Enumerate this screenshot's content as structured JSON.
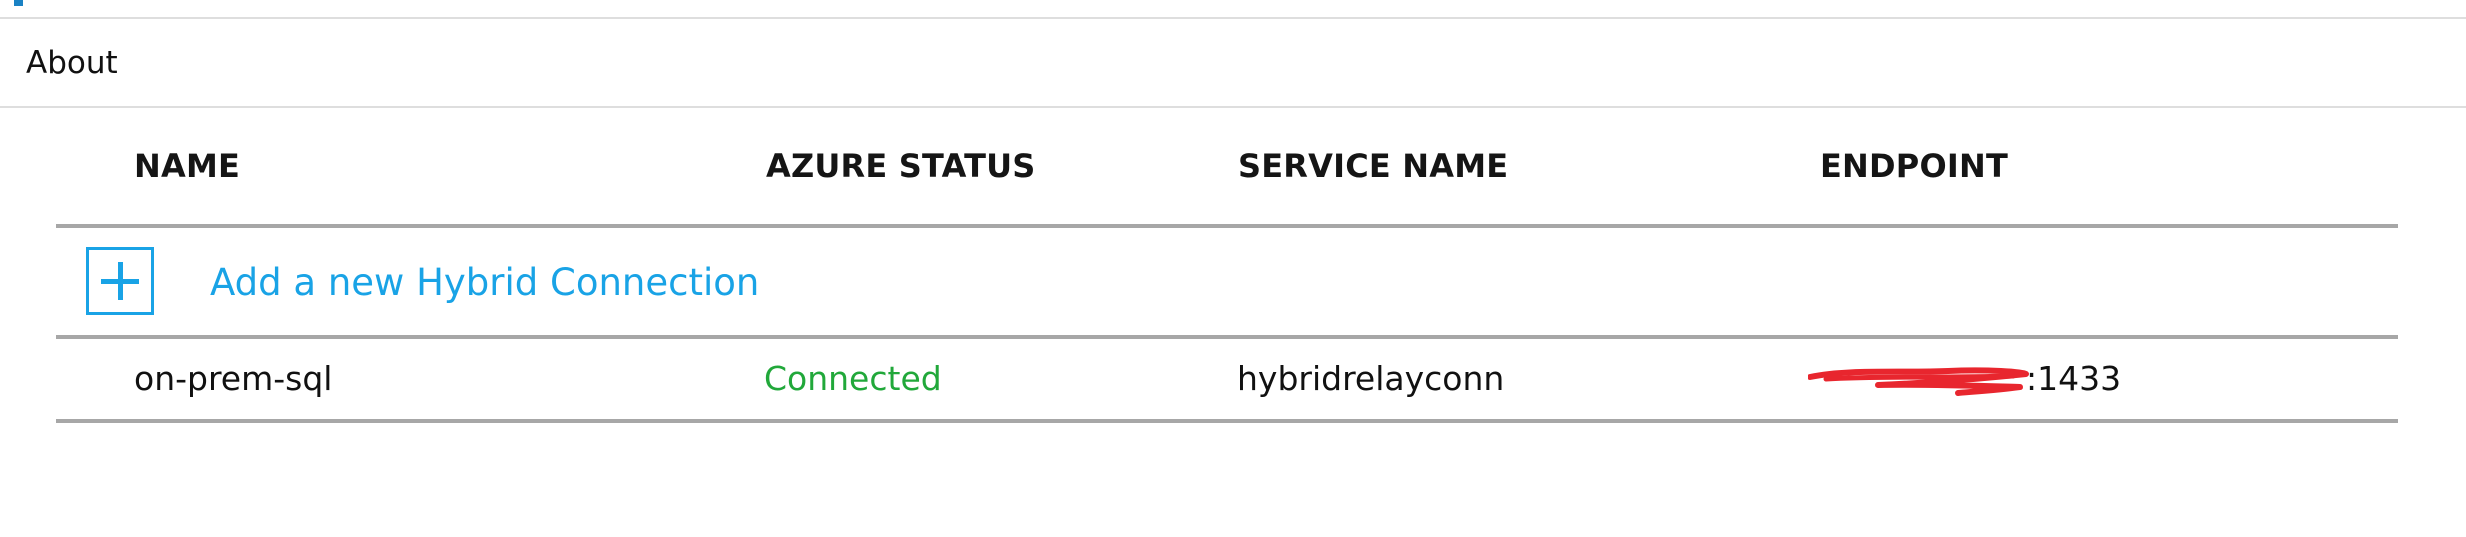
{
  "menu": {
    "about_label": "About"
  },
  "table": {
    "headers": {
      "name": "NAME",
      "azure_status": "AZURE STATUS",
      "service_name": "SERVICE NAME",
      "endpoint": "ENDPOINT"
    },
    "add_connection_label": "Add a new Hybrid Connection",
    "rows": [
      {
        "name": "on-prem-sql",
        "azure_status": "Connected",
        "service_name": "hybridrelayconn",
        "endpoint_port": ":1433"
      }
    ]
  },
  "colors": {
    "accent": "#19a3e6",
    "status_connected": "#21a83a",
    "redaction": "#e8262e",
    "rule": "#a7a7a7"
  },
  "icons": {
    "add": "plus-icon"
  }
}
